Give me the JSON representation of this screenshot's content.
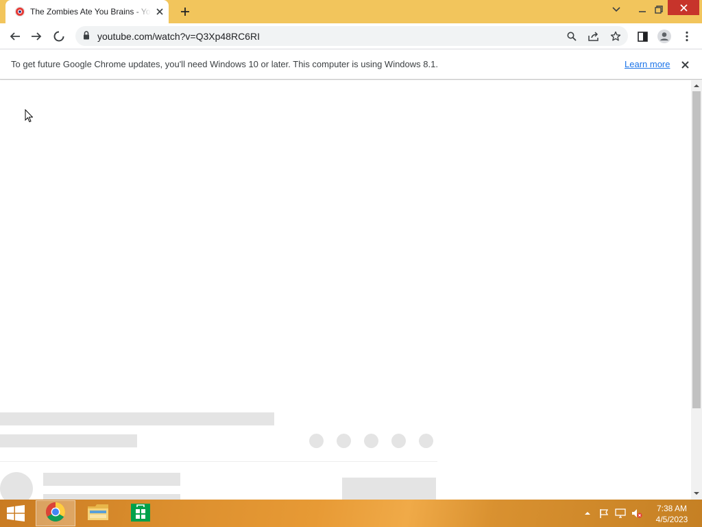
{
  "browser": {
    "tab": {
      "title": "The Zombies Ate You Brains - YouTube",
      "favicon": "youtube-icon"
    },
    "address_bar": {
      "url": "youtube.com/watch?v=Q3Xp48RC6RI",
      "secure_icon": "lock-icon"
    },
    "infobar": {
      "message": "To get future Google Chrome updates, you'll need Windows 10 or later. This computer is using Windows 8.1.",
      "link_label": "Learn more"
    }
  },
  "taskbar": {
    "apps": [
      {
        "name": "Google Chrome",
        "icon": "chrome-icon",
        "active": true
      },
      {
        "name": "File Explorer",
        "icon": "file-explorer-icon",
        "active": false
      },
      {
        "name": "Store",
        "icon": "store-icon",
        "active": false
      }
    ],
    "clock": {
      "time": "7:38 AM",
      "date": "4/5/2023"
    }
  },
  "colors": {
    "frame": "#f2c55c",
    "link": "#1a73e8",
    "skeleton": "#e4e4e4",
    "taskbar": "#dc8f2e"
  }
}
